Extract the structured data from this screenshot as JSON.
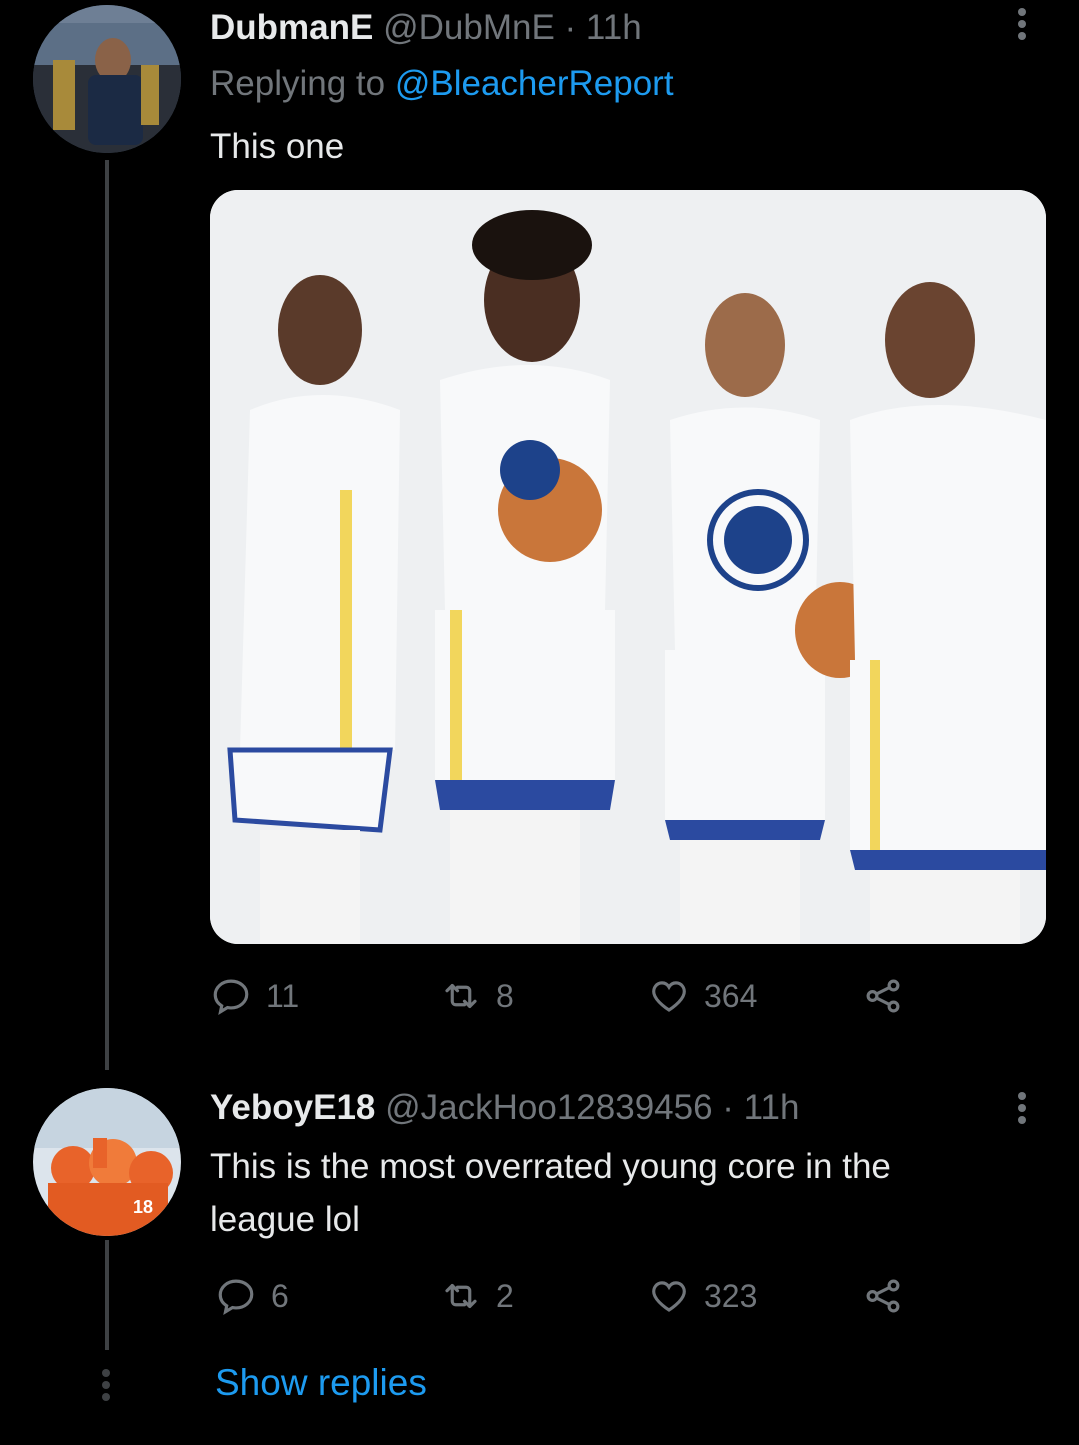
{
  "tweets": [
    {
      "name": "DubmanE",
      "handle": "@DubMnE",
      "time": "· 11h",
      "replying_prefix": "Replying to ",
      "replying_to": "@BleacherReport",
      "text": "This one",
      "avatar_icon": "avatar-championship-photo",
      "stats": {
        "replies": "11",
        "retweets": "8",
        "likes": "364"
      }
    },
    {
      "name": "YeboyE18",
      "handle": "@JackHoo12839456",
      "time": "· 11h",
      "text_line1": "This is the most overrated young core in the",
      "text_line2": "league lol",
      "avatar_icon": "avatar-football-team-photo",
      "stats": {
        "replies": "6",
        "retweets": "2",
        "likes": "323"
      }
    }
  ],
  "show_replies": "Show replies",
  "colors": {
    "background": "#000000",
    "accent": "#1d9bf0",
    "muted": "#71767b",
    "text": "#e7e9ea"
  },
  "icons": [
    "reply-icon",
    "retweet-icon",
    "like-icon",
    "share-icon",
    "more-icon"
  ]
}
